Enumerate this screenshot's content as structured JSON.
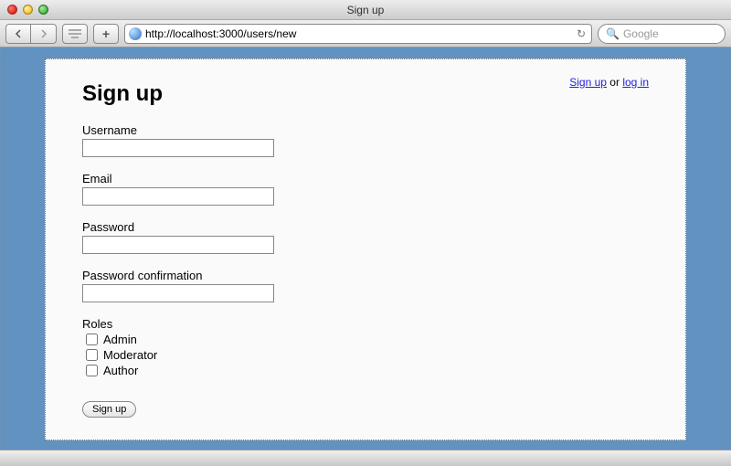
{
  "window": {
    "title": "Sign up"
  },
  "toolbar": {
    "url": "http://localhost:3000/users/new",
    "search_placeholder": "Google"
  },
  "nav": {
    "signup_text": "Sign up",
    "or_text": " or ",
    "login_text": "log in"
  },
  "page": {
    "heading": "Sign up",
    "fields": {
      "username": {
        "label": "Username",
        "value": ""
      },
      "email": {
        "label": "Email",
        "value": ""
      },
      "password": {
        "label": "Password",
        "value": ""
      },
      "password_confirmation": {
        "label": "Password confirmation",
        "value": ""
      }
    },
    "roles_label": "Roles",
    "roles": [
      "Admin",
      "Moderator",
      "Author"
    ],
    "submit_label": "Sign up"
  }
}
